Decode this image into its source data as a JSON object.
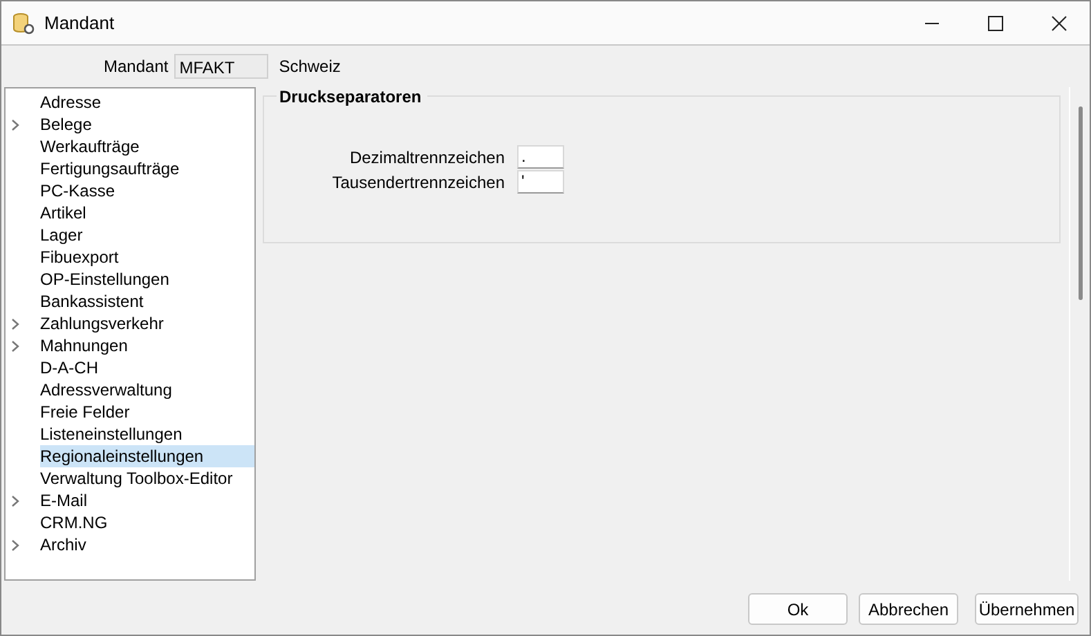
{
  "window": {
    "title": "Mandant"
  },
  "mandant": {
    "label": "Mandant",
    "value": "MFAKT",
    "name": "Schweiz"
  },
  "tree": {
    "items": [
      {
        "label": "Adresse",
        "expandable": false,
        "selected": false
      },
      {
        "label": "Belege",
        "expandable": true,
        "selected": false
      },
      {
        "label": "Werkaufträge",
        "expandable": false,
        "selected": false
      },
      {
        "label": "Fertigungsaufträge",
        "expandable": false,
        "selected": false
      },
      {
        "label": "PC-Kasse",
        "expandable": false,
        "selected": false
      },
      {
        "label": "Artikel",
        "expandable": false,
        "selected": false
      },
      {
        "label": "Lager",
        "expandable": false,
        "selected": false
      },
      {
        "label": "Fibuexport",
        "expandable": false,
        "selected": false
      },
      {
        "label": "OP-Einstellungen",
        "expandable": false,
        "selected": false
      },
      {
        "label": "Bankassistent",
        "expandable": false,
        "selected": false
      },
      {
        "label": "Zahlungsverkehr",
        "expandable": true,
        "selected": false
      },
      {
        "label": "Mahnungen",
        "expandable": true,
        "selected": false
      },
      {
        "label": "D-A-CH",
        "expandable": false,
        "selected": false
      },
      {
        "label": "Adressverwaltung",
        "expandable": false,
        "selected": false
      },
      {
        "label": "Freie Felder",
        "expandable": false,
        "selected": false
      },
      {
        "label": "Listeneinstellungen",
        "expandable": false,
        "selected": false
      },
      {
        "label": "Regionaleinstellungen",
        "expandable": false,
        "selected": true
      },
      {
        "label": "Verwaltung Toolbox-Editor",
        "expandable": false,
        "selected": false
      },
      {
        "label": "E-Mail",
        "expandable": true,
        "selected": false
      },
      {
        "label": "CRM.NG",
        "expandable": false,
        "selected": false
      },
      {
        "label": "Archiv",
        "expandable": true,
        "selected": false
      }
    ]
  },
  "group": {
    "title": "Druckseparatoren",
    "fields": [
      {
        "label": "Dezimaltrennzeichen",
        "value": "."
      },
      {
        "label": "Tausendertrennzeichen",
        "value": "'"
      }
    ]
  },
  "buttons": [
    "Ok",
    "Abbrechen",
    "Übernehmen"
  ]
}
